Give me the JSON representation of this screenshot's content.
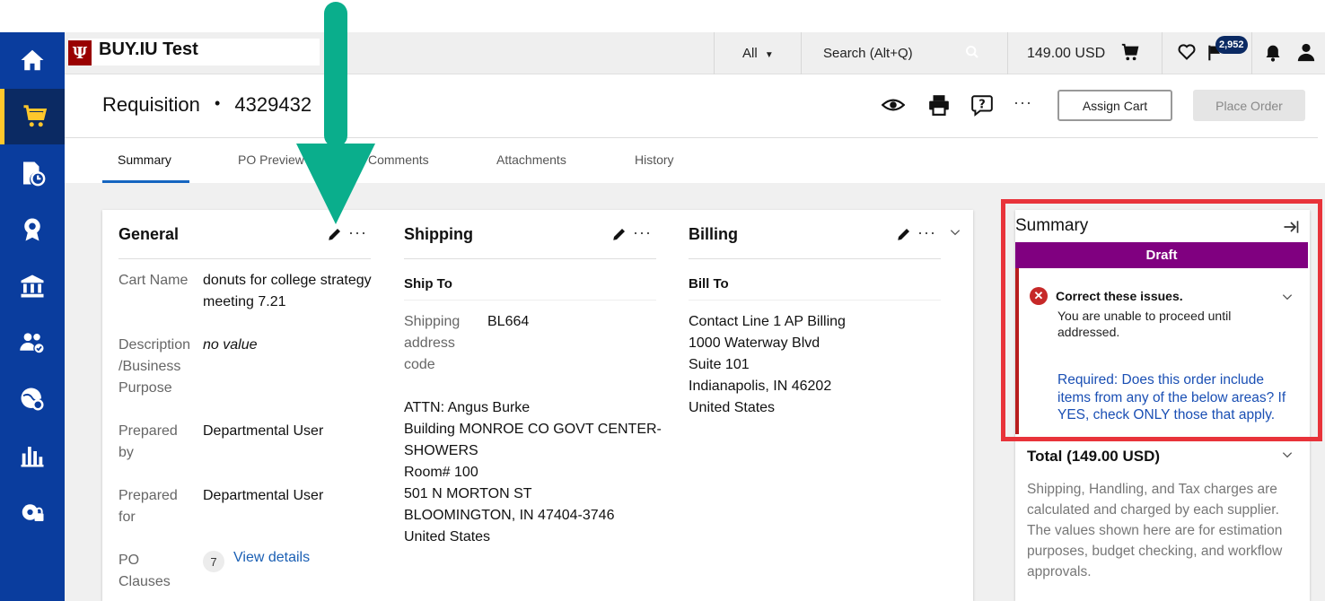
{
  "app": {
    "title": "BUY.IU Test"
  },
  "topbar": {
    "search_scope": "All",
    "search_placeholder": "Search (Alt+Q)",
    "cart_total": "149.00 USD",
    "notifications_count": "2,952"
  },
  "header": {
    "title": "Requisition",
    "separator": "•",
    "number": "4329432",
    "assign_cart_label": "Assign Cart",
    "place_order_label": "Place Order"
  },
  "tabs": [
    {
      "label": "Summary"
    },
    {
      "label": "PO Preview"
    },
    {
      "label": "Comments"
    },
    {
      "label": "Attachments"
    },
    {
      "label": "History"
    }
  ],
  "general": {
    "title": "General",
    "fields": [
      {
        "label": "Cart Name",
        "value": "donuts for college strategy meeting 7.21"
      },
      {
        "label": "Description /Business Purpose",
        "value": "no value"
      },
      {
        "label": "Prepared by",
        "value": "Departmental User"
      },
      {
        "label": "Prepared for",
        "value": "Departmental User"
      },
      {
        "label": "PO Clauses",
        "count": "7",
        "link": "View details"
      }
    ]
  },
  "shipping": {
    "title": "Shipping",
    "subtitle": "Ship To",
    "code_label": "Shipping address code",
    "code_value": "BL664",
    "address": [
      "ATTN: Angus Burke",
      "Building MONROE CO GOVT CENTER-",
      "SHOWERS",
      "Room# 100",
      "501 N MORTON ST",
      "BLOOMINGTON, IN 47404-3746",
      "United States"
    ]
  },
  "billing": {
    "title": "Billing",
    "subtitle": "Bill To",
    "address": [
      "Contact Line 1 AP Billing",
      "1000 Waterway Blvd",
      "Suite 101",
      "Indianapolis, IN 46202",
      "United States"
    ]
  },
  "summary_panel": {
    "title": "Summary",
    "status": "Draft",
    "issue_title": "Correct these issues.",
    "issue_message": "You are unable to proceed until addressed.",
    "issue_link": "Required: Does this order include items from any of the below areas? If YES, check ONLY those that apply.",
    "total_title": "Total (149.00 USD)",
    "total_description": "Shipping, Handling, and Tax charges are calculated and charged by each supplier. The values shown here are for estimation purposes, budget checking, and workflow approvals."
  },
  "colors": {
    "sidebar": "#0a3d9e",
    "sidebar_active_accent": "#ffc72c",
    "draft": "#800080",
    "error": "#c62828",
    "annotation_arrow": "#0aae8c",
    "annotation_frame": "#e8333a",
    "link": "#1a5fb4"
  }
}
